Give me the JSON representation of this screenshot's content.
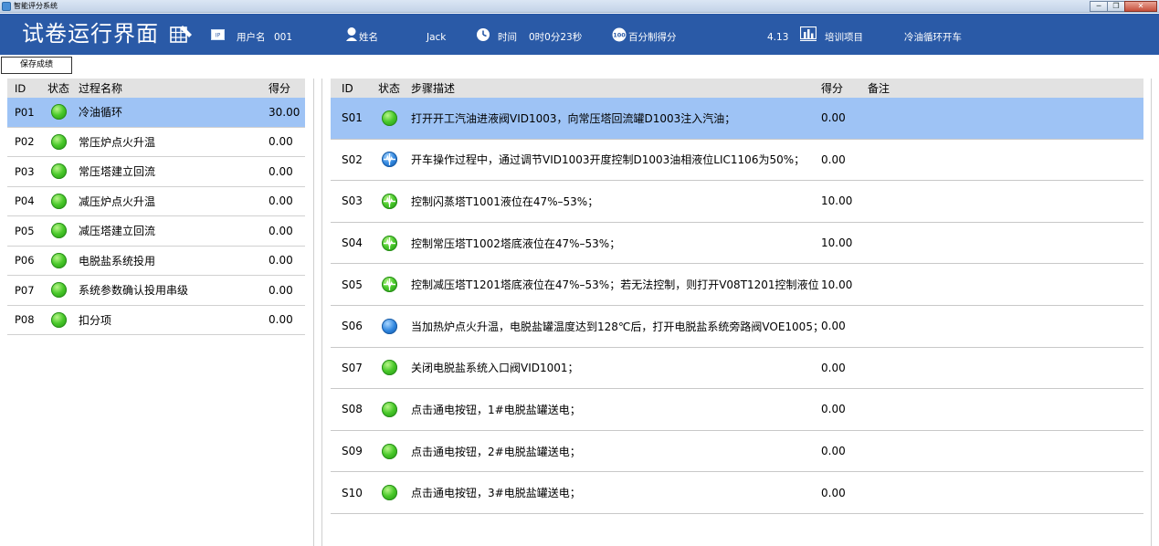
{
  "window": {
    "title": "智能评分系统",
    "buttons": [
      "─",
      "❐",
      "✕"
    ]
  },
  "header": {
    "page_title": "试卷运行界面",
    "user_label": "用户名",
    "user_value": "001",
    "name_label": "姓名",
    "name_value": "Jack",
    "time_label": "时间",
    "time_value": "0时0分23秒",
    "percent_label": "百分制得分",
    "percent_value": "4.13",
    "project_label": "培训项目",
    "project_value": "冷油循环开车",
    "colors": {
      "bar": "#2a5aa7",
      "text": "#ffffff"
    }
  },
  "toolbar": {
    "save_label": "保存成绩"
  },
  "process_table": {
    "headers": [
      "ID",
      "状态",
      "过程名称",
      "得分"
    ],
    "rows": [
      {
        "id": "P01",
        "status": "green",
        "name": "冷油循环",
        "score": "30.00",
        "selected": true
      },
      {
        "id": "P02",
        "status": "green",
        "name": "常压炉点火升温",
        "score": "0.00"
      },
      {
        "id": "P03",
        "status": "green",
        "name": "常压塔建立回流",
        "score": "0.00"
      },
      {
        "id": "P04",
        "status": "green",
        "name": "减压炉点火升温",
        "score": "0.00"
      },
      {
        "id": "P05",
        "status": "green",
        "name": "减压塔建立回流",
        "score": "0.00"
      },
      {
        "id": "P06",
        "status": "green",
        "name": "电脱盐系统投用",
        "score": "0.00"
      },
      {
        "id": "P07",
        "status": "green",
        "name": "系统参数确认投用串级",
        "score": "0.00"
      },
      {
        "id": "P08",
        "status": "green",
        "name": "扣分项",
        "score": "0.00"
      }
    ]
  },
  "step_table": {
    "headers": [
      "ID",
      "状态",
      "步骤描述",
      "得分",
      "备注"
    ],
    "rows": [
      {
        "id": "S01",
        "status": "green",
        "desc": "打开开工汽油进液阀VID1003，向常压塔回流罐D1003注入汽油；",
        "score": "0.00",
        "selected": true
      },
      {
        "id": "S02",
        "status": "blue-wave",
        "desc": "开车操作过程中，通过调节VID1003开度控制D1003油相液位LIC1106为50%；",
        "score": "0.00"
      },
      {
        "id": "S03",
        "status": "green-wave",
        "desc": "控制闪蒸塔T1001液位在47%–53%；",
        "score": "10.00"
      },
      {
        "id": "S04",
        "status": "green-wave",
        "desc": "控制常压塔T1002塔底液位在47%–53%；",
        "score": "10.00"
      },
      {
        "id": "S05",
        "status": "green-wave",
        "desc": "控制减压塔T1201塔底液位在47%–53%；若无法控制，则打开V08T1201控制液位",
        "score": "10.00"
      },
      {
        "id": "S06",
        "status": "blue",
        "desc": "当加热炉点火升温，电脱盐罐温度达到128℃后，打开电脱盐系统旁路阀VOE1005；",
        "score": "0.00"
      },
      {
        "id": "S07",
        "status": "green",
        "desc": "关闭电脱盐系统入口阀VID1001；",
        "score": "0.00"
      },
      {
        "id": "S08",
        "status": "green",
        "desc": "点击通电按钮，1#电脱盐罐送电；",
        "score": "0.00"
      },
      {
        "id": "S09",
        "status": "green",
        "desc": "点击通电按钮，2#电脱盐罐送电；",
        "score": "0.00"
      },
      {
        "id": "S10",
        "status": "green",
        "desc": "点击通电按钮，3#电脱盐罐送电；",
        "score": "0.00"
      }
    ]
  },
  "colors": {
    "selected_row": "#9ec3f5",
    "table_header": "#e2e2e2",
    "status_green": "#49c92a",
    "status_blue": "#2f86df"
  }
}
